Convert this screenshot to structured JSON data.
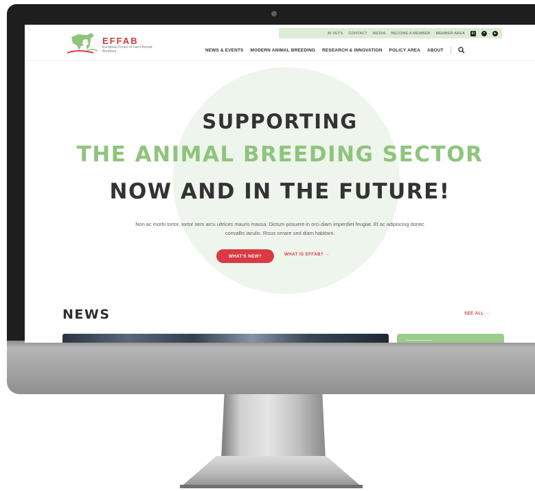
{
  "site": {
    "logo_title": "EFFAB",
    "logo_subtitle": "European Forum of Farm Animal Breeders"
  },
  "utility_nav": {
    "items": [
      "AI VETS",
      "CONTACT",
      "MEDIA",
      "BECOME A MEMBER",
      "MEMBER AREA"
    ],
    "icons": [
      "linkedin-icon",
      "twitter-icon",
      "youtube-icon"
    ]
  },
  "main_nav": {
    "items": [
      "NEWS & EVENTS",
      "MODERN ANIMAL BREEDING",
      "RESEARCH & INNOVATION",
      "POLICY AREA",
      "ABOUT"
    ]
  },
  "hero": {
    "line1": "SUPPORTING",
    "line2": "THE ANIMAL BREEDING SECTOR",
    "line3": "NOW AND IN THE FUTURE!",
    "body": "Non ac morbi tortor, tortor sem arcu ultrices mauris massa. Dictum posuere in orci diam imperdiet feugiat. Et ac adipiscing donec convallis iaculis. Risus ornare sed diam habitant.",
    "primary_cta": "WHAT'S NEW?",
    "secondary_cta": "WHAT IS EFFAB?  →"
  },
  "news": {
    "title": "NEWS",
    "see_all": "SEE ALL  →"
  },
  "colors": {
    "accent_red": "#d93a44",
    "accent_green": "#8fc47d",
    "utility_bar": "#dcecd5",
    "hero_circle": "#eef5ec",
    "bezel": "#1e1e1f"
  }
}
